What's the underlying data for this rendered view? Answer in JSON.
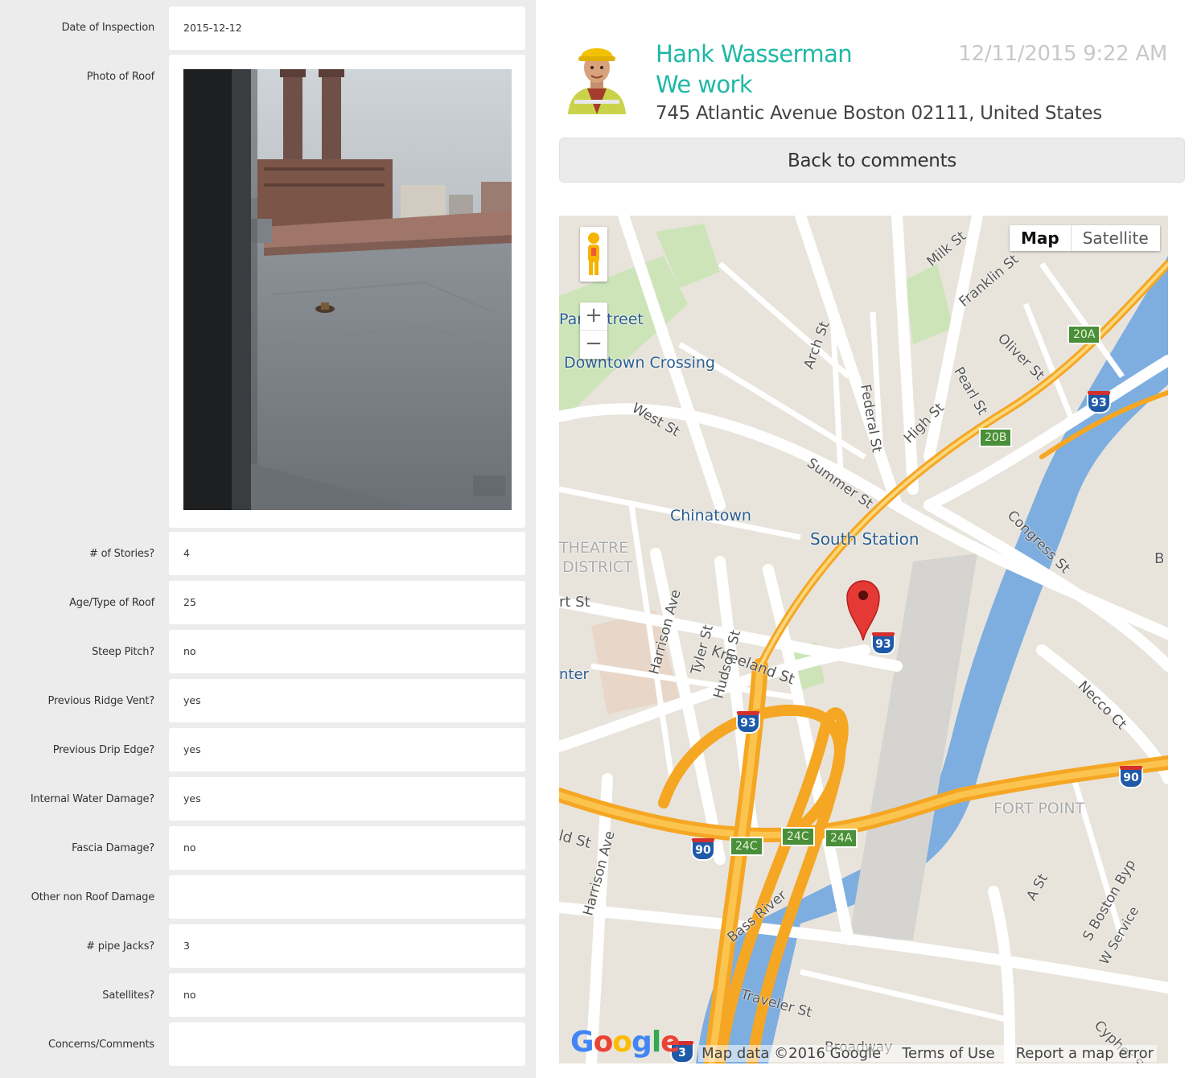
{
  "form": {
    "date_label": "Date of Inspection",
    "date_value": "2015-12-12",
    "photo_label": "Photo of Roof",
    "rows": [
      {
        "label": "# of Stories?",
        "value": "4"
      },
      {
        "label": "Age/Type of Roof",
        "value": "25"
      },
      {
        "label": "Steep Pitch?",
        "value": "no"
      },
      {
        "label": "Previous Ridge Vent?",
        "value": "yes"
      },
      {
        "label": "Previous Drip Edge?",
        "value": "yes"
      },
      {
        "label": "Internal Water Damage?",
        "value": "yes"
      },
      {
        "label": "Fascia Damage?",
        "value": "no"
      },
      {
        "label": "Other non Roof Damage",
        "value": ""
      },
      {
        "label": "# pipe Jacks?",
        "value": "3"
      },
      {
        "label": "Satellites?",
        "value": "no"
      },
      {
        "label": "Concerns/Comments",
        "value": ""
      }
    ]
  },
  "comment": {
    "name": "Hank Wasserman",
    "company": "We work",
    "address": "745 Atlantic Avenue Boston 02111, United States",
    "timestamp": "12/11/2015 9:22 AM",
    "back_label": "Back to comments"
  },
  "map": {
    "type_map": "Map",
    "type_satellite": "Satellite",
    "zoom_in": "+",
    "zoom_out": "−",
    "logo": "Google",
    "attribution": [
      "Map data ©2016 Google",
      "Terms of Use",
      "Report a map error"
    ],
    "labels": {
      "park_street": "Park Street",
      "downtown_crossing": "Downtown Crossing",
      "chinatown": "Chinatown",
      "south_station": "South Station",
      "theatre": "THEATRE",
      "district": "DISTRICT",
      "fort_point": "FORT POINT",
      "milk_st": "Milk St",
      "franklin_st": "Franklin St",
      "oliver_st": "Oliver St",
      "pearl_st": "Pearl St",
      "arch_st": "Arch St",
      "federal_st": "Federal St",
      "west_st": "West St",
      "high_st": "High St",
      "summer_st": "Summer St",
      "congress_st": "Congress St",
      "kneeland_st": "Kneeland St",
      "harrison_ave": "Harrison Ave",
      "tyler_st": "Tyler St",
      "hudson_st": "Hudson St",
      "necco_ct": "Necco Ct",
      "harrison_ave_2": "Harrison Ave",
      "bass_river": "Bass River",
      "traveler_st": "Traveler St",
      "a_st": "A St",
      "s_boston_byp": "S Boston Byp",
      "w_service": "W Service",
      "cypher_st": "Cypher St",
      "broadway": "Broadway",
      "essex_st": "rt St",
      "center": "nter",
      "old_st": "ld St",
      "b_m": "B M"
    },
    "shields": {
      "i93_a": "93",
      "i93_b": "93",
      "i93_c": "93",
      "i93_d": "3",
      "i90_a": "90",
      "i90_b": "90"
    },
    "exits": {
      "e20a": "20A",
      "e20b": "20B",
      "e24c_a": "24C",
      "e24c_b": "24C",
      "e24a": "24A"
    }
  }
}
